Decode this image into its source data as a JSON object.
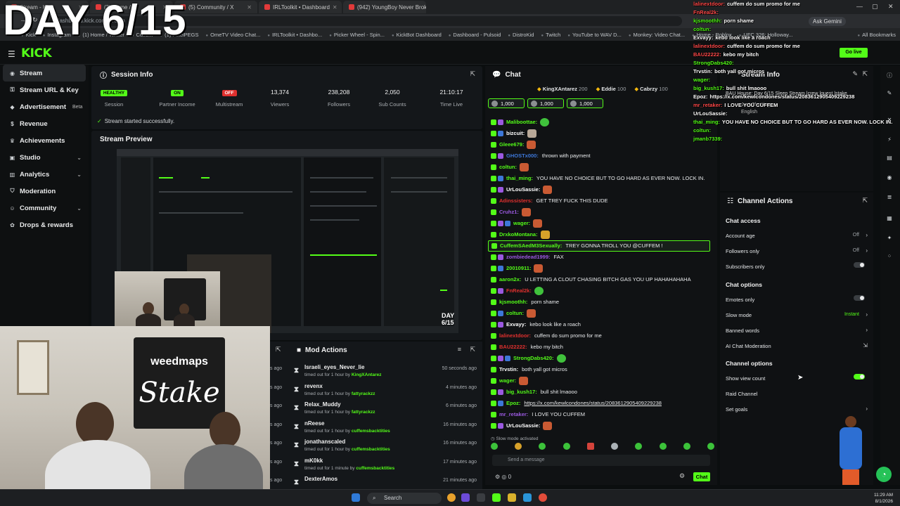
{
  "overlay_title": "DAY 6/15",
  "browser": {
    "tabs": [
      "Stream - Kick",
      "(3) Home / X",
      "(5) Community / X",
      "IRLToolkit • Dashboard",
      "(942) YoungBoy Never Broke A..."
    ],
    "address": "dashboard.kick.com/stream",
    "ask_gemini": "Ask Gemini",
    "bookmarks": [
      "Kick",
      "Instagram",
      "(1) Home / Twitter",
      "Cuffem",
      "(1) PixelPEGS",
      "OmeTV Video Chat...",
      "IRLToolkit • Dashbo...",
      "Picker Wheel - Spin...",
      "KickBot Dashboard",
      "Dashboard - Pulsoid",
      "DistroKid",
      "Twitch",
      "YouTube to WAV D...",
      "Monkey: Video Chat...",
      "Home - Roblox",
      "UFC 326: Holloway..."
    ],
    "all_bookmarks": "All Bookmarks"
  },
  "kick": {
    "logo": "KICK",
    "go_live": "Go live"
  },
  "sidebar": {
    "items": [
      {
        "label": "Stream",
        "icon": "broadcast-icon",
        "active": true
      },
      {
        "label": "Stream URL & Key",
        "icon": "key-icon"
      },
      {
        "label": "Advertisement",
        "icon": "megaphone-icon",
        "badge": "Beta"
      },
      {
        "label": "Revenue",
        "icon": "dollar-icon"
      },
      {
        "label": "Achievements",
        "icon": "trophy-icon"
      },
      {
        "label": "Studio",
        "icon": "studio-icon",
        "chevron": true
      },
      {
        "label": "Analytics",
        "icon": "chart-icon",
        "chevron": true
      },
      {
        "label": "Moderation",
        "icon": "shield-icon"
      },
      {
        "label": "Community",
        "icon": "people-icon",
        "chevron": true
      },
      {
        "label": "Drops & rewards",
        "icon": "gift-icon"
      }
    ]
  },
  "session": {
    "title": "Session Info",
    "metrics": [
      {
        "value": "HEALTHY",
        "label": "Session",
        "kind": "ok"
      },
      {
        "value": "ON",
        "label": "Partner Income",
        "kind": "ok"
      },
      {
        "value": "OFF",
        "label": "Multistream",
        "kind": "off"
      },
      {
        "value": "13,374",
        "label": "Viewers"
      },
      {
        "value": "238,208",
        "label": "Followers"
      },
      {
        "value": "2,050",
        "label": "Sub Counts"
      },
      {
        "value": "21:10:17",
        "label": "Time Live"
      }
    ],
    "status": "Stream started successfully."
  },
  "preview": {
    "title": "Stream Preview"
  },
  "webcam": {
    "banner_top": "weedmaps",
    "banner_main": "Stake"
  },
  "mod_actions": {
    "title": "Mod Actions",
    "rows": [
      {
        "name": "Israeli_eyes_Never_lie",
        "desc": "timed out for 1 hour by",
        "by": "KingXAntarez",
        "time": "50 seconds ago"
      },
      {
        "name": "revenx",
        "desc": "timed out for 1 hour by",
        "by": "fattyrackzz",
        "time": "4 minutes ago"
      },
      {
        "name": "Relax_Muddy",
        "desc": "timed out for 1 hour by",
        "by": "fattyrackzz",
        "time": "6 minutes ago"
      },
      {
        "name": "nReese",
        "desc": "timed out for 1 hour by",
        "by": "cuffemsbacktities",
        "time": "16 minutes ago"
      },
      {
        "name": "jonathanscaled",
        "desc": "timed out for 1 hour by",
        "by": "cuffemsbacktities",
        "time": "16 minutes ago"
      },
      {
        "name": "mK0kk",
        "desc": "timed out for 1 minute by",
        "by": "cuffemsbacktities",
        "time": "17 minutes ago"
      },
      {
        "name": "DexterAmos",
        "desc": "",
        "by": "",
        "time": "21 minutes ago"
      }
    ],
    "ago_labels": [
      "s ago",
      "s ago",
      "s ago",
      "s ago",
      "s ago",
      "s ago",
      "s ago"
    ]
  },
  "chat": {
    "title": "Chat",
    "top_gifters": [
      {
        "name": "KingXAntarez",
        "count": "200"
      },
      {
        "name": "Eddie",
        "count": "100"
      },
      {
        "name": "Cabrzy",
        "count": "100"
      }
    ],
    "sub_pills": [
      "1,000",
      "1,000",
      "1,000"
    ],
    "messages": [
      {
        "user": "Maliboottae:",
        "text": "",
        "color": "#53fc18",
        "emo": "g"
      },
      {
        "user": "bizcuit:",
        "text": "",
        "color": "#ffffff",
        "emo": "w"
      },
      {
        "user": "Gleee679:",
        "text": "",
        "color": "#53fc18",
        "emo": "r"
      },
      {
        "user": "GHOSTx000:",
        "text": "thrown with payment",
        "color": "#3d77d8"
      },
      {
        "user": "coltun:",
        "text": "",
        "color": "#53fc18",
        "emo": "r"
      },
      {
        "user": "thai_ming:",
        "text": "YOU HAVE NO CHOICE BUT TO GO HARD AS EVER NOW. LOCK IN.",
        "color": "#53fc18"
      },
      {
        "user": "UrLouSassie:",
        "text": "",
        "color": "#ffffff",
        "emo": "r"
      },
      {
        "user": "Adinssisters:",
        "text": "GET TREY FUCK THIS DUDE",
        "color": "#e0302e"
      },
      {
        "user": "Cruhz1:",
        "text": "",
        "color": "#9b59e0",
        "emo": "r"
      },
      {
        "user": "wager:",
        "text": "",
        "color": "#53fc18",
        "emo": "r"
      },
      {
        "user": "DrxkoMontana:",
        "text": "",
        "color": "#53fc18",
        "emo": "y"
      },
      {
        "user": "CuffemSAedM3Sexually:",
        "text": "TREY GONNA TROLL YOU @CUFFEM !",
        "color": "#53fc18",
        "highlight": true
      },
      {
        "user": "zombiedead1999:",
        "text": "FAX",
        "color": "#9b59e0"
      },
      {
        "user": "20010911:",
        "text": "",
        "color": "#53fc18",
        "emo": "r"
      },
      {
        "user": "aaron2x:",
        "text": "U LETTING A CLOUT CHASING BITCH GAS YOU UP HAHAHAHAHA",
        "color": "#53fc18"
      },
      {
        "user": "FnReal2k:",
        "text": "",
        "color": "#e0302e",
        "emo": "g"
      },
      {
        "user": "kjsmoothh:",
        "text": "porn shame",
        "color": "#53fc18"
      },
      {
        "user": "coltun:",
        "text": "",
        "color": "#53fc18",
        "emo": "r"
      },
      {
        "user": "Exvayy:",
        "text": "kebo look like a roach",
        "color": "#ffffff"
      },
      {
        "user": "lalinextdoor:",
        "text": "cuffem do sum promo for me",
        "color": "#e0302e"
      },
      {
        "user": "BAU22222:",
        "text": "kebo my bitch",
        "color": "#e0302e"
      },
      {
        "user": "StrongDabs420:",
        "text": "",
        "color": "#53fc18",
        "emo": "g"
      },
      {
        "user": "Trvstin:",
        "text": "both yall got micros",
        "color": "#ffffff"
      },
      {
        "user": "wager:",
        "text": "",
        "color": "#53fc18",
        "emo": "r"
      },
      {
        "user": "big_kush17:",
        "text": "bull shit lmaooo",
        "color": "#53fc18"
      },
      {
        "user": "Epoz:",
        "text": "https://x.com/kewlcondones/status/2083612905409229238",
        "color": "#53fc18",
        "link": true
      },
      {
        "user": "mr_retaker:",
        "text": "I LOVE YOU CUFFEM",
        "color": "#9b59e0"
      },
      {
        "user": "UrLouSassie:",
        "text": "",
        "color": "#ffffff",
        "emo": "r"
      }
    ],
    "slow_mode_note": "Slow mode activated",
    "input_placeholder": "Send a message",
    "chat_button": "Chat",
    "points": "0"
  },
  "stream_info": {
    "title": "Stream Info",
    "overlay_text": "BAU House: Day 6/15 Sleep Stream |crew |guest |stake",
    "category": "Just Chatting",
    "language": "English"
  },
  "channel_actions": {
    "title": "Channel Actions",
    "chat_access": "Chat access",
    "account_age": {
      "label": "Account age",
      "value": "Off"
    },
    "followers_only": {
      "label": "Followers only",
      "value": "Off"
    },
    "subscribers_only": {
      "label": "Subscribers only"
    },
    "chat_options": "Chat options",
    "emotes_only": {
      "label": "Emotes only"
    },
    "slow_mode": {
      "label": "Slow mode",
      "value": "Instant"
    },
    "banned_words": {
      "label": "Banned words"
    },
    "ai_moderation": {
      "label": "AI Chat Moderation"
    },
    "channel_options": "Channel options",
    "show_view_count": {
      "label": "Show view count",
      "on": true
    },
    "raid_channel": {
      "label": "Raid Channel"
    },
    "set_goals": {
      "label": "Set goals"
    }
  },
  "overlay_chat": [
    {
      "user": "lalinextdoor:",
      "text": "cuffem do sum promo for me",
      "color": "#ff4a4a"
    },
    {
      "user": "FnReal2k:",
      "text": "",
      "color": "#ff4a4a"
    },
    {
      "user": "kjsmoothh:",
      "text": "porn shame",
      "color": "#53fc18"
    },
    {
      "user": "coltun:",
      "text": "",
      "color": "#53fc18"
    },
    {
      "user": "Exvayy:",
      "text": "kebo look like a roach",
      "color": "#ffffff"
    },
    {
      "user": "lalinextdoor:",
      "text": "cuffem do sum promo for me",
      "color": "#ff4a4a"
    },
    {
      "user": "BAU22222:",
      "text": "kebo my bitch",
      "color": "#ff4a4a"
    },
    {
      "user": "StrongDabs420:",
      "text": "",
      "color": "#53fc18"
    },
    {
      "user": "Trvstin:",
      "text": "both yall got micros",
      "color": "#ffffff"
    },
    {
      "user": "wager:",
      "text": "",
      "color": "#53fc18"
    },
    {
      "user": "big_kush17:",
      "text": "bull shit lmaooo",
      "color": "#53fc18"
    },
    {
      "user": "Epoz:",
      "text": "https://x.com/kewlcondones/status/2083612905409229238",
      "color": "#ffffff"
    },
    {
      "user": "mr_retaker:",
      "text": "I LOVE YOU CUFFEM",
      "color": "#ff4a4a"
    },
    {
      "user": "UrLouSassie:",
      "text": "",
      "color": "#ffffff"
    },
    {
      "user": "thai_ming:",
      "text": "YOU HAVE NO CHOICE BUT TO GO HARD AS EVER NOW. LOCK IN.",
      "color": "#53fc18"
    },
    {
      "user": "coltun:",
      "text": "",
      "color": "#53fc18"
    },
    {
      "user": "jmanb7339:",
      "text": "",
      "color": "#53fc18"
    }
  ],
  "taskbar": {
    "search": "Search",
    "time": "11:29 AM",
    "date": "8/1/2026"
  },
  "colors": {
    "accent": "#53fc18",
    "danger": "#e0302e",
    "bg": "#0b0e0f",
    "panel": "#14171a"
  }
}
